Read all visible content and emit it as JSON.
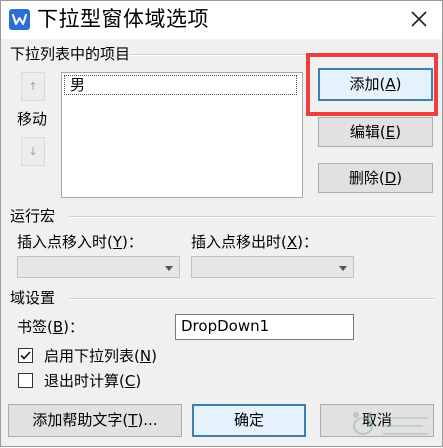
{
  "dialog": {
    "title": "下拉型窗体域选项",
    "close_glyph": "✕"
  },
  "list_group": {
    "header": "下拉列表中的项目",
    "move_label": "移动",
    "up_glyph": "↑",
    "down_glyph": "↓",
    "items": [
      "男"
    ]
  },
  "buttons": {
    "add": "添加(A)",
    "add_key": "A",
    "edit": "编辑(E)",
    "edit_key": "E",
    "delete": "删除(D)",
    "delete_key": "D"
  },
  "macro_group": {
    "header": "运行宏",
    "entry_label": "插入点移入时(Y)：",
    "entry_key": "Y",
    "exit_label": "插入点移出时(X)：",
    "exit_key": "X",
    "entry_value": "",
    "exit_value": ""
  },
  "field_group": {
    "header": "域设置",
    "bookmark_label": "书签(B)：",
    "bookmark_key": "B",
    "bookmark_value": "DropDown1",
    "enable_dropdown_label": "启用下拉列表(N)",
    "enable_dropdown_key": "N",
    "enable_dropdown_checked": true,
    "calc_on_exit_label": "退出时计算(C)",
    "calc_on_exit_key": "C",
    "calc_on_exit_checked": false
  },
  "footer": {
    "help_text": "添加帮助文字(T)...",
    "help_key": "T",
    "ok": "确定",
    "cancel": "取消"
  },
  "colors": {
    "highlight": "#ea4040",
    "accent": "#2b6fd6",
    "default_border": "#3c7fb1"
  }
}
